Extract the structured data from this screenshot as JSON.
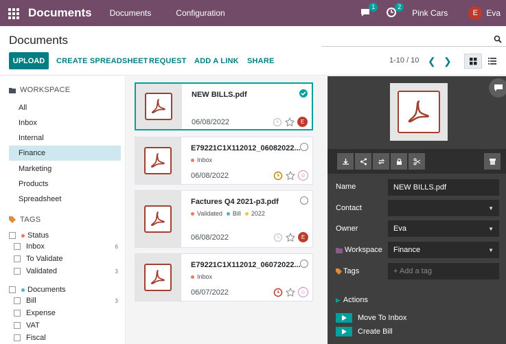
{
  "navbar": {
    "app_title": "Documents",
    "menu": [
      "Documents",
      "Configuration"
    ],
    "messages_count": "1",
    "activities_count": "2",
    "company": "Pink Cars",
    "user_initial": "E",
    "user_name": "Eva"
  },
  "control_panel": {
    "title": "Documents",
    "buttons": {
      "upload": "UPLOAD",
      "create_spreadsheet": "CREATE SPREADSHEET",
      "request": "REQUEST",
      "add_link": "ADD A LINK",
      "share": "SHARE"
    },
    "pager": "1-10 / 10"
  },
  "sidebar": {
    "workspace_header": "WORKSPACE",
    "workspaces": [
      "All",
      "Inbox",
      "Internal",
      "Finance",
      "Marketing",
      "Products",
      "Spreadsheet"
    ],
    "active_workspace": "Finance",
    "tags_header": "TAGS",
    "groups": [
      {
        "name": "Status",
        "color": "#e87a5d",
        "tags": [
          {
            "label": "Inbox",
            "count": "6"
          },
          {
            "label": "To Validate",
            "count": ""
          },
          {
            "label": "Validated",
            "count": "3"
          }
        ]
      },
      {
        "name": "Documents",
        "color": "#4fb0c6",
        "tags": [
          {
            "label": "Bill",
            "count": "3"
          },
          {
            "label": "Expense",
            "count": ""
          },
          {
            "label": "VAT",
            "count": ""
          },
          {
            "label": "Fiscal",
            "count": ""
          }
        ]
      }
    ]
  },
  "cards": [
    {
      "name": "NEW BILLS.pdf",
      "tags": [],
      "date": "06/08/2022",
      "selected": true,
      "avatar": "E",
      "avatar_color": "#c0392b",
      "activity_color": "#cccccc"
    },
    {
      "name": "E79221C1X112012_06082022...",
      "tags": [
        {
          "label": "Inbox",
          "color": "#e87a5d"
        }
      ],
      "date": "06/08/2022",
      "selected": false,
      "avatar": "☺",
      "avatar_color": "#c38ac0",
      "activity_color": "#b8860b"
    },
    {
      "name": "Factures Q4 2021-p3.pdf",
      "tags": [
        {
          "label": "Validated",
          "color": "#e87a5d"
        },
        {
          "label": "Bill",
          "color": "#4fb0c6"
        },
        {
          "label": "2022",
          "color": "#e6c84a"
        }
      ],
      "date": "06/08/2022",
      "selected": false,
      "avatar": "E",
      "avatar_color": "#c0392b",
      "activity_color": "#cccccc"
    },
    {
      "name": "E79221C1X112012_06072022...",
      "tags": [
        {
          "label": "Inbox",
          "color": "#e87a5d"
        }
      ],
      "date": "06/07/2022",
      "selected": false,
      "avatar": "☺",
      "avatar_color": "#c38ac0",
      "activity_color": "#c0392b"
    }
  ],
  "inspector": {
    "fields": {
      "name_label": "Name",
      "name_value": "NEW BILLS.pdf",
      "contact_label": "Contact",
      "contact_value": "",
      "owner_label": "Owner",
      "owner_value": "Eva",
      "workspace_label": "Workspace",
      "workspace_value": "Finance",
      "tags_label": "Tags",
      "tags_placeholder": "+ Add a tag"
    },
    "actions_title": "Actions",
    "actions": [
      "Move To Inbox",
      "Create Bill"
    ]
  }
}
